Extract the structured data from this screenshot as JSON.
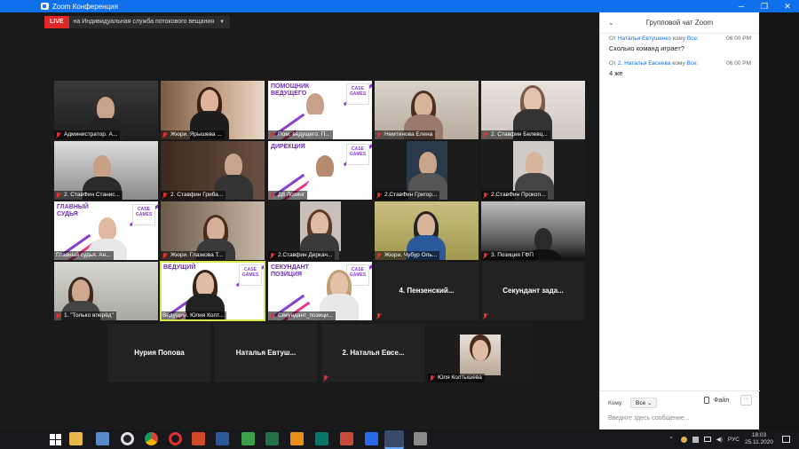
{
  "window": {
    "title": "Zoom Конференция",
    "controls": [
      "─",
      "❐",
      "✕"
    ]
  },
  "live": {
    "badge": "LIVE",
    "info": "на Индивидуальная служба потокового вещания"
  },
  "tiles": [
    {
      "label": "Администратор. А...",
      "muted": true
    },
    {
      "label": "Жюри. Ярышева ...",
      "muted": true
    },
    {
      "label": "Пом. ведущего. П...",
      "muted": true,
      "banner": "ПОМОЩНИК ВЕДУЩЕГО"
    },
    {
      "label": "Немтинова Елена",
      "muted": true
    },
    {
      "label": "2. Ставфин Белевц...",
      "muted": true
    },
    {
      "label": "2. СтавФин Станис...",
      "muted": true
    },
    {
      "label": "2. Ставфин Гриба...",
      "muted": true
    },
    {
      "label": "Д8 Лозинг",
      "muted": true,
      "banner": "ДИРЕКЦИЯ"
    },
    {
      "label": "2.СтавФин Григор...",
      "muted": true
    },
    {
      "label": "2.СтавФин Прокоп...",
      "muted": true
    },
    {
      "label": "Главный судья. Ан...",
      "muted": false,
      "banner": "ГЛАВНЫЙ СУДЬЯ"
    },
    {
      "label": "Жюри. Глазкова Т...",
      "muted": true
    },
    {
      "label": "2.Ставфин Деркач...",
      "muted": true
    },
    {
      "label": "Жюри. Чубур Оль...",
      "muted": true
    },
    {
      "label": "3. Позиция ГФП",
      "muted": true
    },
    {
      "label": "1. \"Только вперёд\"",
      "muted": true
    },
    {
      "label": "Ведущий. Юлия Колт...",
      "muted": false,
      "banner": "ВЕДУЩИЙ"
    },
    {
      "label": "Секундант_позици...",
      "muted": true,
      "banner": "СЕКУНДАНТ ПОЗИЦИЯ"
    },
    {
      "name": "4.  Пензенский...",
      "muted": true
    },
    {
      "name": "Секундант  зада...",
      "muted": true
    },
    {
      "name": "Нурия Попова",
      "muted": false
    },
    {
      "name": "Наталья  Евтуш...",
      "muted": false
    },
    {
      "name": "2. Наталья  Евсе...",
      "muted": true
    },
    {
      "label": "Юля Колтышева",
      "muted": true
    }
  ],
  "logo_text": "CASE GAMES",
  "chat": {
    "title": "Групповой чат Zoom",
    "messages": [
      {
        "from_prefix": "От",
        "from": "Наталья Евтушенко",
        "to_prefix": "кому",
        "to": "Все:",
        "time": "06:00 PM",
        "text": "Сколько команд играет?"
      },
      {
        "from_prefix": "От",
        "from": "2. Наталья Евсеева",
        "to_prefix": "кому",
        "to": "Все:",
        "time": "06:00 PM",
        "text": "4 же"
      }
    ],
    "to_label": "Кому:",
    "to_value": "Все",
    "file_label": "Файл",
    "more_label": "···",
    "input_placeholder": "Введите здесь сообщение..."
  },
  "taskbar": {
    "lang": "РУС",
    "time": "18:03",
    "date": "25.11.2020"
  },
  "colors": {
    "zoom_blue": "#0e71eb",
    "live_red": "#e02828",
    "active_speaker": "#d9e84a"
  }
}
